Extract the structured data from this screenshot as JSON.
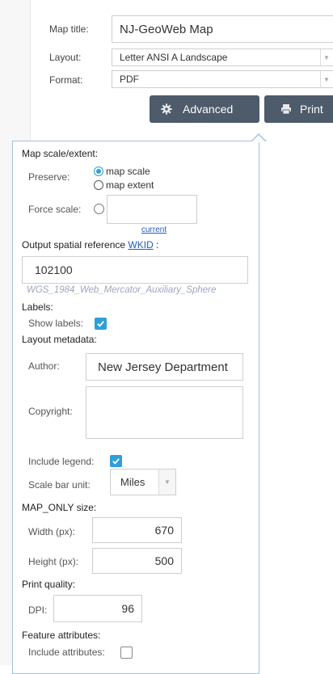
{
  "print_form": {
    "map_title_label": "Map title:",
    "map_title_value": "NJ-GeoWeb Map",
    "layout_label": "Layout:",
    "layout_value": "Letter ANSI A Landscape",
    "format_label": "Format:",
    "format_value": "PDF",
    "advanced_label": "Advanced",
    "print_label": "Print"
  },
  "advanced": {
    "scale_section": "Map scale/extent:",
    "preserve_label": "Preserve:",
    "option_map_scale": "map scale",
    "option_map_extent": "map extent",
    "selected_option": "map scale",
    "force_scale_label": "Force scale:",
    "force_scale_value": "",
    "current_link": "current",
    "sr_section_prefix": "Output spatial reference ",
    "sr_link": "WKID",
    "sr_section_suffix": " :",
    "wkid_value": "102100",
    "wkid_hint": "WGS_1984_Web_Mercator_Auxiliary_Sphere",
    "labels_section": "Labels:",
    "show_labels_label": "Show labels:",
    "show_labels_checked": true,
    "metadata_section": "Layout metadata:",
    "author_label": "Author:",
    "author_value": "New Jersey Department",
    "copyright_label": "Copyright:",
    "copyright_value": "",
    "include_legend_label": "Include legend:",
    "include_legend_checked": true,
    "scale_bar_label": "Scale bar unit:",
    "scale_bar_value": "Miles",
    "maponly_section": "MAP_ONLY size:",
    "width_label": "Width (px):",
    "width_value": "670",
    "height_label": "Height (px):",
    "height_value": "500",
    "quality_section": "Print quality:",
    "dpi_label": "DPI:",
    "dpi_value": "96",
    "attributes_section": "Feature attributes:",
    "include_attributes_label": "Include attributes:",
    "include_attributes_checked": false
  },
  "colors": {
    "button_bg": "#4d5b6a",
    "accent_blue": "#2f9fd8",
    "panel_border": "#9fc3df"
  },
  "icons": {
    "advanced": "gear-icon",
    "print": "printer-icon",
    "checkbox_checked": "check-icon",
    "select": "chevron-down-icon"
  }
}
